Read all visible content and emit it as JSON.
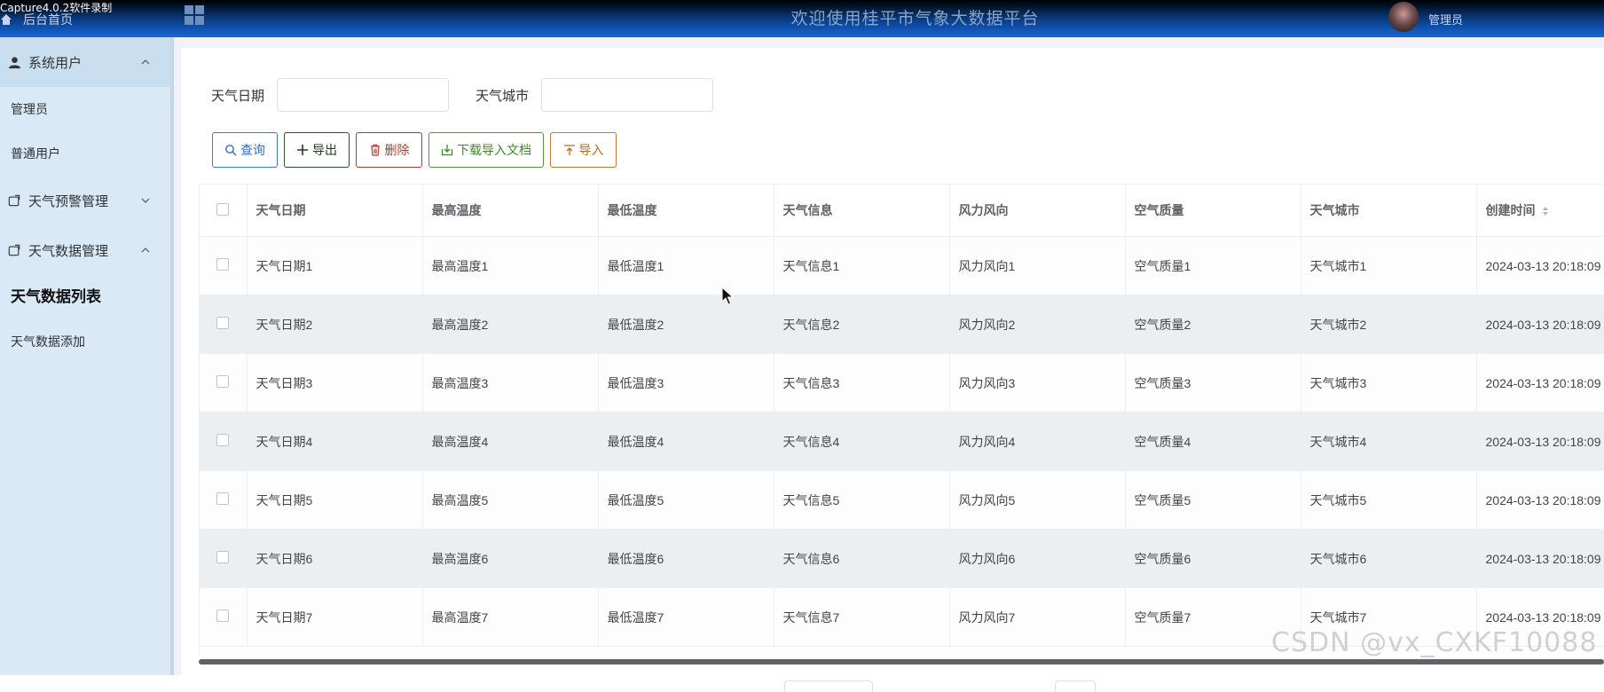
{
  "overlay": {
    "capture_watermark": "Capture4.0.2软件录制",
    "csdn_watermark": "CSDN @vx_CXKF10088"
  },
  "header": {
    "home_label": "后台首页",
    "title": "欢迎使用桂平市气象大数据平台",
    "user_name": "管理员"
  },
  "sidebar": {
    "groups": [
      {
        "label": "系统用户",
        "icon": "user-icon",
        "expanded": true,
        "items": [
          {
            "label": "管理员"
          },
          {
            "label": "普通用户"
          }
        ]
      },
      {
        "label": "天气预警管理",
        "icon": "folder-icon",
        "expanded": false,
        "items": []
      },
      {
        "label": "天气数据管理",
        "icon": "folder-icon",
        "expanded": true,
        "items": [
          {
            "label": "天气数据列表"
          },
          {
            "label": "天气数据添加"
          }
        ]
      }
    ]
  },
  "search": {
    "date_label": "天气日期",
    "date_value": "",
    "city_label": "天气城市",
    "city_value": ""
  },
  "toolbar": {
    "query_label": "查询",
    "export_label": "导出",
    "delete_label": "删除",
    "download_label": "下载导入文档",
    "import_label": "导入"
  },
  "table": {
    "columns": [
      "天气日期",
      "最高温度",
      "最低温度",
      "天气信息",
      "风力风向",
      "空气质量",
      "天气城市",
      "创建时间"
    ],
    "rows": [
      [
        "天气日期1",
        "最高温度1",
        "最低温度1",
        "天气信息1",
        "风力风向1",
        "空气质量1",
        "天气城市1",
        "2024-03-13 20:18:09"
      ],
      [
        "天气日期2",
        "最高温度2",
        "最低温度2",
        "天气信息2",
        "风力风向2",
        "空气质量2",
        "天气城市2",
        "2024-03-13 20:18:09"
      ],
      [
        "天气日期3",
        "最高温度3",
        "最低温度3",
        "天气信息3",
        "风力风向3",
        "空气质量3",
        "天气城市3",
        "2024-03-13 20:18:09"
      ],
      [
        "天气日期4",
        "最高温度4",
        "最低温度4",
        "天气信息4",
        "风力风向4",
        "空气质量4",
        "天气城市4",
        "2024-03-13 20:18:09"
      ],
      [
        "天气日期5",
        "最高温度5",
        "最低温度5",
        "天气信息5",
        "风力风向5",
        "空气质量5",
        "天气城市5",
        "2024-03-13 20:18:09"
      ],
      [
        "天气日期6",
        "最高温度6",
        "最低温度6",
        "天气信息6",
        "风力风向6",
        "空气质量6",
        "天气城市6",
        "2024-03-13 20:18:09"
      ],
      [
        "天气日期7",
        "最高温度7",
        "最低温度7",
        "天气信息7",
        "风力风向7",
        "空气质量7",
        "天气城市7",
        "2024-03-13 20:18:09"
      ]
    ]
  },
  "colors": {
    "header_top": "#000000",
    "header_bottom": "#1668d8",
    "sidebar_bg": "#d9e9f5",
    "query_blue": "#2f6fd0",
    "delete_red": "#b03a2e",
    "download_green": "#3f8a2b",
    "import_orange": "#b36a25"
  }
}
